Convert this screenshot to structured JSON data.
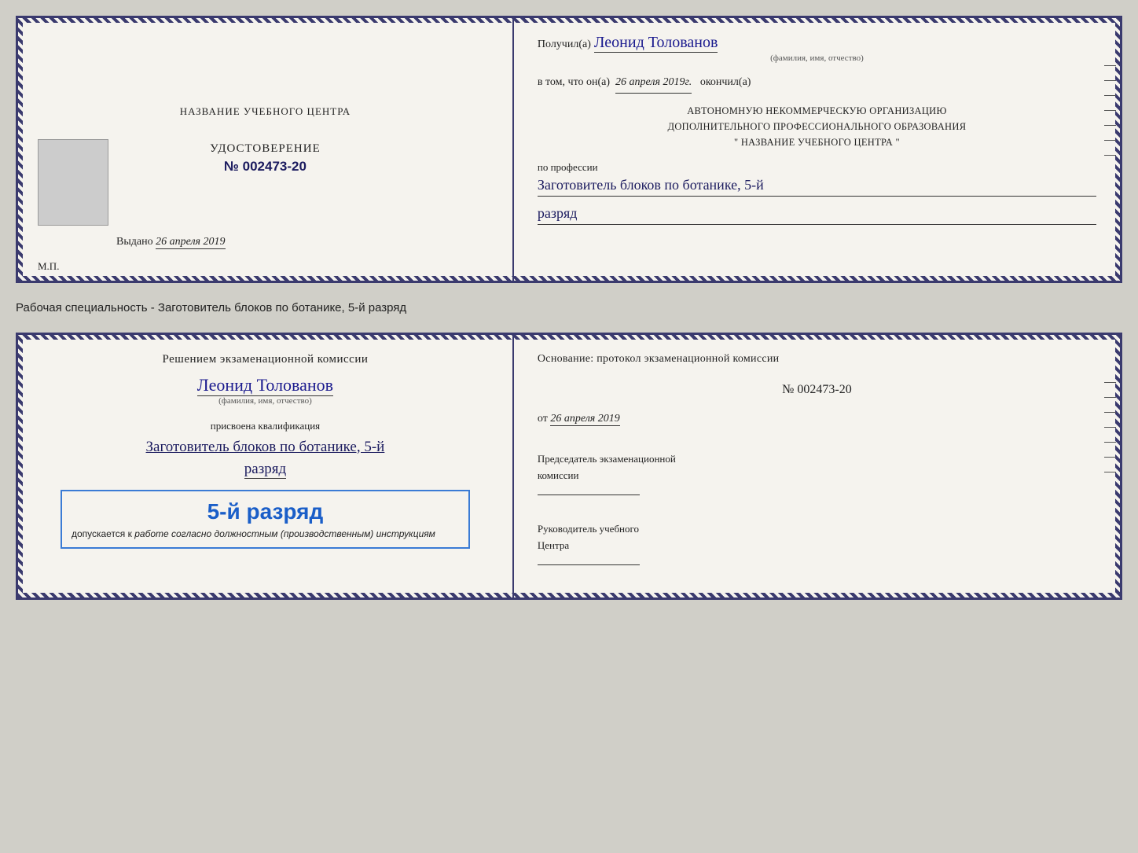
{
  "top_doc": {
    "left": {
      "training_center": "НАЗВАНИЕ УЧЕБНОГО ЦЕНТРА",
      "certificate_label": "УДОСТОВЕРЕНИЕ",
      "certificate_number": "№ 002473-20",
      "issued_label": "Выдано",
      "issued_date": "26 апреля 2019",
      "mp_label": "М.П."
    },
    "right": {
      "received_prefix": "Получил(а)",
      "recipient_name": "Леонид Толованов",
      "fio_hint": "(фамилия, имя, отчество)",
      "date_prefix": "в том, что он(а)",
      "date_handwritten": "26 апреля 2019г.",
      "date_suffix": "окончил(а)",
      "org_line1": "АВТОНОМНУЮ НЕКОММЕРЧЕСКУЮ ОРГАНИЗАЦИЮ",
      "org_line2": "ДОПОЛНИТЕЛЬНОГО ПРОФЕССИОНАЛЬНОГО ОБРАЗОВАНИЯ",
      "org_line3": "\" НАЗВАНИЕ УЧЕБНОГО ЦЕНТРА \"",
      "profession_prefix": "по профессии",
      "profession_handwritten": "Заготовитель блоков по ботанике, 5-й",
      "rank_handwritten": "разряд"
    }
  },
  "specialty_label": "Рабочая специальность - Заготовитель блоков по ботанике, 5-й разряд",
  "bottom_doc": {
    "left": {
      "commission_text": "Решением экзаменационной комиссии",
      "person_name": "Леонид Толованов",
      "fio_hint": "(фамилия, имя, отчество)",
      "assigned_label": "присвоена квалификация",
      "qualification_handwritten": "Заготовитель блоков по ботанике, 5-й",
      "rank_handwritten": "разряд",
      "stamp_rank": "5-й разряд",
      "stamp_allowed_prefix": "допускается к",
      "stamp_allowed_italic": "работе согласно должностным (производственным) инструкциям"
    },
    "right": {
      "basis_text": "Основание: протокол экзаменационной комиссии",
      "protocol_number": "№ 002473-20",
      "from_prefix": "от",
      "from_date": "26 апреля 2019",
      "chairman_label1": "Председатель экзаменационной",
      "chairman_label2": "комиссии",
      "head_label1": "Руководитель учебного",
      "head_label2": "Центра"
    }
  }
}
